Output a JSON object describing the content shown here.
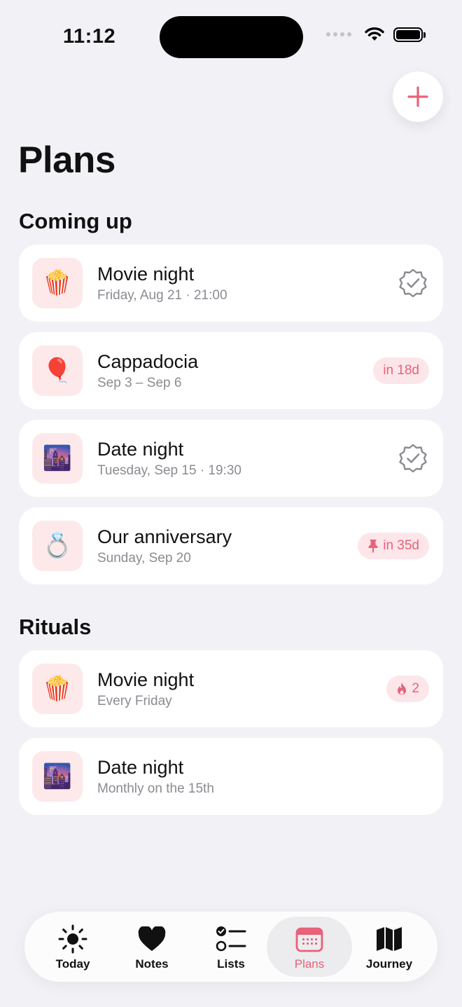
{
  "status_bar": {
    "time": "11:12"
  },
  "header": {
    "title": "Plans",
    "add_icon": "plus-icon"
  },
  "coming_up": {
    "title": "Coming up",
    "items": [
      {
        "emoji": "🍿",
        "title": "Movie night",
        "subtitle": "Friday, Aug 21 · 21:00",
        "badge_icon": "verified-badge-icon"
      },
      {
        "emoji": "🎈",
        "title": "Cappadocia",
        "subtitle": "Sep 3 – Sep 6",
        "badge": "in 18d"
      },
      {
        "emoji": "🌆",
        "title": "Date night",
        "subtitle": "Tuesday, Sep 15 · 19:30",
        "badge_icon": "verified-badge-icon"
      },
      {
        "emoji": "💍",
        "title": "Our anniversary",
        "subtitle": "Sunday, Sep 20",
        "badge": "in 35d",
        "badge_icon": "pin-icon"
      }
    ]
  },
  "rituals": {
    "title": "Rituals",
    "items": [
      {
        "emoji": "🍿",
        "title": "Movie night",
        "subtitle": "Every Friday",
        "badge": "2",
        "badge_icon": "flame-icon"
      },
      {
        "emoji": "🌆",
        "title": "Date night",
        "subtitle": "Monthly on the 15th"
      }
    ]
  },
  "tabbar": {
    "tabs": [
      {
        "label": "Today",
        "icon": "sun-icon"
      },
      {
        "label": "Notes",
        "icon": "heart-icon"
      },
      {
        "label": "Lists",
        "icon": "checklist-icon"
      },
      {
        "label": "Plans",
        "icon": "calendar-icon",
        "active": true
      },
      {
        "label": "Journey",
        "icon": "map-icon"
      }
    ]
  },
  "colors": {
    "accent": "#e86279",
    "accent_bg": "#fde6ea",
    "background": "#f2f2f6"
  }
}
